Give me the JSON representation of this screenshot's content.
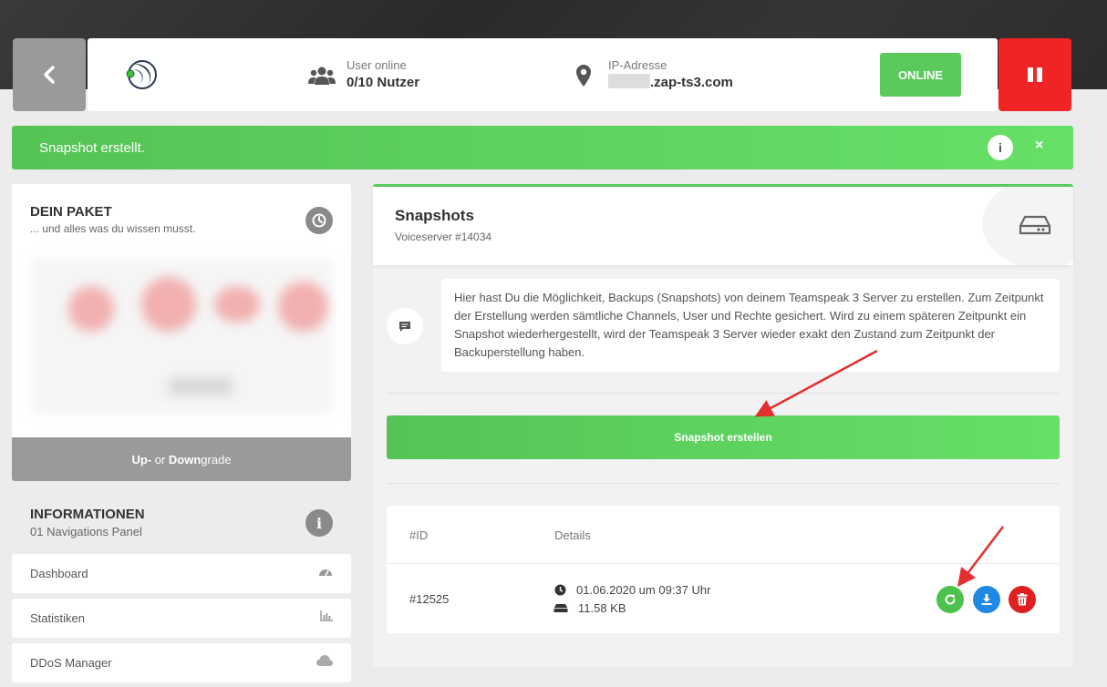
{
  "header": {
    "users_label": "User online",
    "users_value": "0/10 Nutzer",
    "ip_label": "IP-Adresse",
    "ip_domain": ".zap-ts3.com",
    "status_button": "ONLINE"
  },
  "alert": {
    "message": "Snapshot erstellt.",
    "info_glyph": "i",
    "close_glyph": "×"
  },
  "paket": {
    "title": "DEIN PAKET",
    "subtitle": "... und alles was du wissen musst.",
    "upgrade_bold_up": "Up-",
    "upgrade_or": " or ",
    "upgrade_bold_down": "Down",
    "upgrade_grade": "grade"
  },
  "info": {
    "title": "INFORMATIONEN",
    "subtitle": "01 Navigations Panel",
    "icon_glyph": "i"
  },
  "nav": {
    "items": [
      {
        "label": "Dashboard",
        "icon": "gauge-icon"
      },
      {
        "label": "Statistiken",
        "icon": "bar-chart-icon"
      },
      {
        "label": "DDoS Manager",
        "icon": "cloud-icon"
      }
    ]
  },
  "snapshots": {
    "title": "Snapshots",
    "subtitle": "Voiceserver #14034",
    "description": "Hier hast Du die Möglichkeit, Backups (Snapshots) von deinem Teamspeak 3 Server zu erstellen. Zum Zeitpunkt der Erstellung werden sämtliche Channels, User und Rechte gesichert. Wird zu einem späteren Zeitpunkt ein Snapshot wiederhergestellt, wird der Teamspeak 3 Server wieder exakt den Zustand zum Zeitpunkt der Backuperstellung haben.",
    "create_button": "Snapshot erstellen",
    "table": {
      "col_id": "#ID",
      "col_details": "Details",
      "rows": [
        {
          "id": "#12525",
          "date": "01.06.2020 um 09:37 Uhr",
          "size": "11.58 KB"
        }
      ]
    }
  },
  "colors": {
    "accent_green": "#5cc95c",
    "danger_red": "#f02424",
    "download_blue": "#1e88e5",
    "delete_red": "#e02020"
  }
}
